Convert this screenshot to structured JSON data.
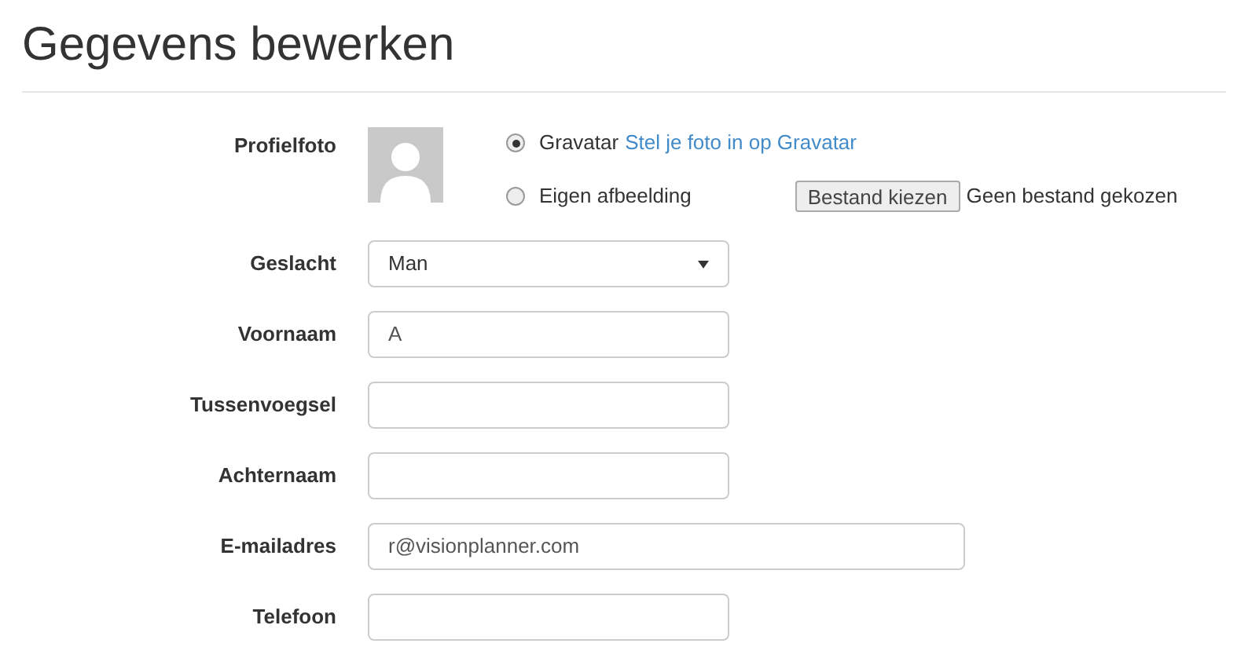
{
  "title": "Gegevens bewerken",
  "profile_photo": {
    "label": "Profielfoto",
    "options": [
      {
        "kind": "gravatar",
        "label": "Gravatar",
        "link": "Stel je foto in op Gravatar",
        "selected": true
      },
      {
        "kind": "upload",
        "label": "Eigen afbeelding",
        "button": "Bestand kiezen",
        "status": "Geen bestand gekozen",
        "selected": false
      }
    ]
  },
  "fields": [
    {
      "kind": "select",
      "label": "Geslacht",
      "value": "Man"
    },
    {
      "kind": "text",
      "label": "Voornaam",
      "value": "A"
    },
    {
      "kind": "text",
      "label": "Tussenvoegsel"
    },
    {
      "kind": "text",
      "label": "Achternaam"
    },
    {
      "kind": "email",
      "label": "E-mailadres",
      "value": "r@visionplanner.com"
    },
    {
      "kind": "text",
      "label": "Telefoon"
    }
  ]
}
